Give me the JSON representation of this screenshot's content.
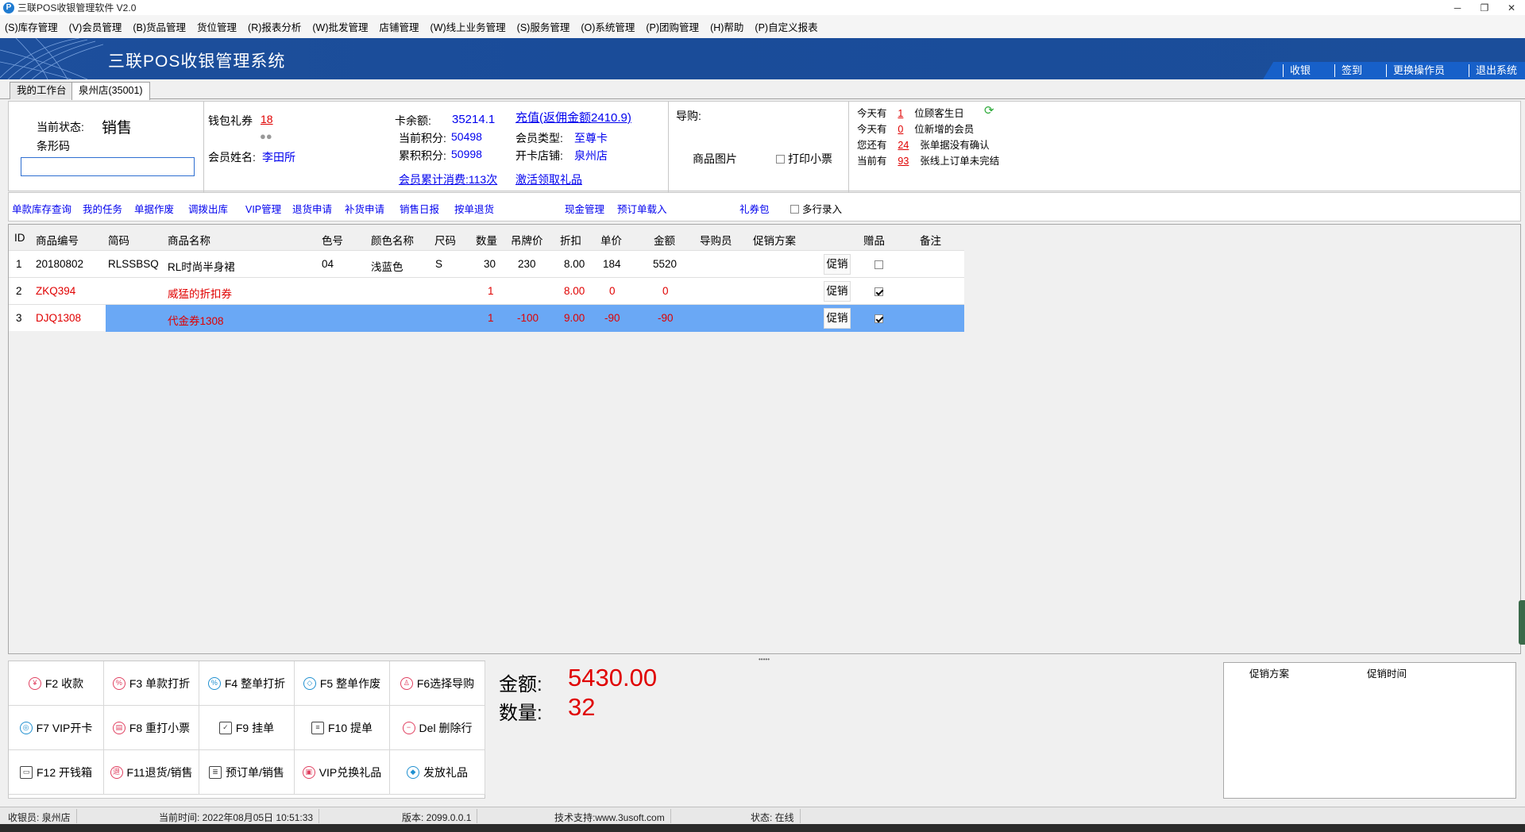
{
  "window": {
    "title": "三联POS收银管理软件 V2.0",
    "app_icon": "P",
    "controls": {
      "minimize": "─",
      "restore": "❐",
      "close": "✕"
    }
  },
  "menu": [
    "(S)库存管理",
    "(V)会员管理",
    "(B)货品管理",
    "货位管理",
    "(R)报表分析",
    "(W)批发管理",
    "店铺管理",
    "(W)线上业务管理",
    "(S)服务管理",
    "(O)系统管理",
    "(P)团购管理",
    "(H)帮助",
    "(P)自定义报表"
  ],
  "banner": {
    "title": "三联POS收银管理系统",
    "actions": [
      "收银",
      "签到",
      "更换操作员",
      "退出系统"
    ]
  },
  "tabs": [
    "我的工作台",
    "泉州店(35001)"
  ],
  "status_panel": {
    "state_label": "当前状态:",
    "state_value": "销售",
    "barcode_label": "条形码",
    "barcode_value": ""
  },
  "member": {
    "wallet_label": "钱包礼券",
    "wallet_value": "18",
    "name_label": "会员姓名:",
    "name_value": "李田所",
    "balance_label": "卡余额:",
    "balance_value": "35214.1",
    "recharge_link": "充值(返佣金额2410.9)",
    "points_label": "当前积分:",
    "points_value": "50498",
    "accum_label": "累积积分:",
    "accum_value": "50998",
    "type_label": "会员类型:",
    "type_value": "至尊卡",
    "store_label": "开卡店铺:",
    "store_value": "泉州店",
    "consume_link": "会员累计消费:113次",
    "gift_link": "激活领取礼品"
  },
  "guide": {
    "label": "导购:",
    "image_label": "商品图片",
    "print_label": "打印小票"
  },
  "notices": [
    {
      "prefix": "今天有",
      "count": "1",
      "suffix": "位顾客生日"
    },
    {
      "prefix": "今天有",
      "count": "0",
      "suffix": "位新增的会员"
    },
    {
      "prefix": "您还有",
      "count": "24",
      "suffix": "张单据没有确认"
    },
    {
      "prefix": "当前有",
      "count": "93",
      "suffix": "张线上订单未完结"
    }
  ],
  "toolbar": [
    "单款库存查询",
    "我的任务",
    "单据作废",
    "调拨出库",
    "VIP管理",
    "退货申请",
    "补货申请",
    "销售日报",
    "按单退货",
    "现金管理",
    "预订单载入",
    "礼券包"
  ],
  "multi_entry_label": "多行录入",
  "grid": {
    "columns": [
      "ID",
      "商品编号",
      "简码",
      "商品名称",
      "色号",
      "颜色名称",
      "尺码",
      "数量",
      "吊牌价",
      "折扣",
      "单价",
      "金额",
      "导购员",
      "促销方案",
      "赠品",
      "备注"
    ],
    "promo_button": "促销",
    "rows": [
      {
        "id": "1",
        "code": "20180802",
        "short": "RLSSBSQ",
        "name": "RL时尚半身裙",
        "color_no": "04",
        "color": "浅蓝色",
        "size": "S",
        "qty": "30",
        "tag": "230",
        "disc": "8.00",
        "price": "184",
        "amount": "5520",
        "gift": false,
        "style": "normal"
      },
      {
        "id": "2",
        "code": "ZKQ394",
        "short": "",
        "name": "威猛的折扣券",
        "color_no": "",
        "color": "",
        "size": "",
        "qty": "1",
        "tag": "",
        "disc": "8.00",
        "price": "0",
        "amount": "0",
        "gift": true,
        "style": "red"
      },
      {
        "id": "3",
        "code": "DJQ1308",
        "short": "",
        "name": "代金券1308",
        "color_no": "",
        "color": "",
        "size": "",
        "qty": "1",
        "tag": "-100",
        "disc": "9.00",
        "price": "-90",
        "amount": "-90",
        "gift": true,
        "style": "selected"
      }
    ]
  },
  "fkeys": [
    {
      "label": "F2 收款",
      "icon": "yen-icon"
    },
    {
      "label": "F3 单款打折",
      "icon": "percent-icon"
    },
    {
      "label": "F4 整单打折",
      "icon": "percent-icon"
    },
    {
      "label": "F5 整单作废",
      "icon": "eraser-icon"
    },
    {
      "label": "F6选择导购",
      "icon": "person-icon"
    },
    {
      "label": "F7 VIP开卡",
      "icon": "vip-card-icon"
    },
    {
      "label": "F8 重打小票",
      "icon": "printer-icon"
    },
    {
      "label": "F9 挂单",
      "icon": "clipboard-icon"
    },
    {
      "label": "F10 提单",
      "icon": "document-icon"
    },
    {
      "label": "Del 删除行",
      "icon": "minus-circle-icon"
    },
    {
      "label": "F12 开钱箱",
      "icon": "cash-drawer-icon"
    },
    {
      "label": "F11退货/销售",
      "icon": "return-icon"
    },
    {
      "label": "预订单/销售",
      "icon": "list-icon"
    },
    {
      "label": "VIP兑换礼品",
      "icon": "gift-icon"
    },
    {
      "label": "发放礼品",
      "icon": "ticket-icon"
    }
  ],
  "totals": {
    "amount_label": "金额:",
    "amount_value": "5430.00",
    "qty_label": "数量:",
    "qty_value": "32"
  },
  "promo_panel": {
    "col1": "促销方案",
    "col2": "促销时间"
  },
  "statusbar": {
    "cashier": "收银员: 泉州店",
    "time": "当前时间: 2022年08月05日 10:51:33",
    "version": "版本: 2099.0.0.1",
    "support": "技术支持:www.3usoft.com",
    "state": "状态: 在线"
  },
  "colors": {
    "banner": "#1d4f9c",
    "accent_red": "#e00000",
    "link_blue": "#0000ee",
    "selected_row": "#6aa8f5"
  }
}
